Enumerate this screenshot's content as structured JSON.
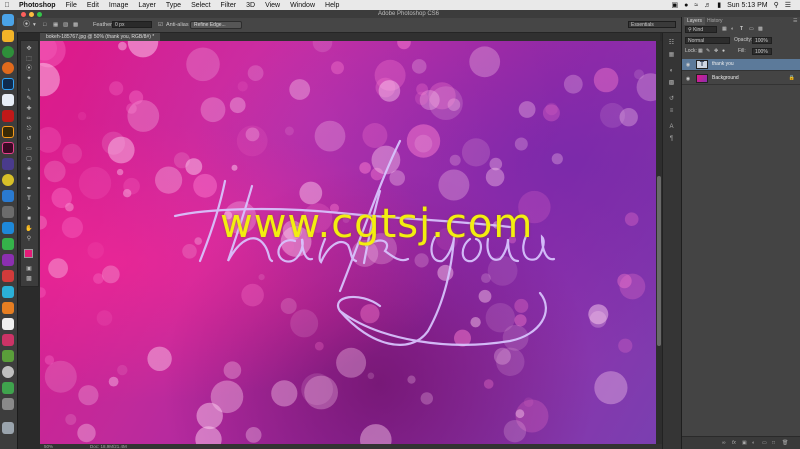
{
  "menubar": {
    "app_name": "Photoshop",
    "items": [
      "File",
      "Edit",
      "Image",
      "Layer",
      "Type",
      "Select",
      "Filter",
      "3D",
      "View",
      "Window",
      "Help"
    ],
    "clock": "Sun 5:13 PM"
  },
  "window": {
    "title": "Adobe Photoshop CS6"
  },
  "options_bar": {
    "feather_label": "Feather:",
    "feather_value": "0 px",
    "anti_alias_label": "Anti-alias",
    "refine_edge_label": "Refine Edge...",
    "workspace_value": "Essentials"
  },
  "document": {
    "tab_title": "bokeh-185767.jpg @ 50% (thank you, RGB/8#) *",
    "script_text": "thank you",
    "watermark": "www.cgtsj.com"
  },
  "status_bar": {
    "zoom": "50%",
    "doc_size": "Doc: 18.9M/21.4M"
  },
  "layers_panel": {
    "tabs": [
      "Layers",
      "History"
    ],
    "kind_value": "Kind",
    "blend_mode": "Normal",
    "opacity_label": "Opacity:",
    "opacity_value": "100%",
    "lock_label": "Lock:",
    "fill_label": "Fill:",
    "fill_value": "100%",
    "layers": [
      {
        "name": "thank you",
        "type": "text",
        "selected": true
      },
      {
        "name": "Background",
        "type": "image",
        "selected": false,
        "locked": true
      }
    ]
  },
  "colors": {
    "foreground": "#e41a78",
    "background": "#ffffff",
    "watermark": "#f3ee10",
    "script": "#d9c6ff"
  },
  "dock_icons": [
    "finder-icon",
    "safari-icon",
    "chrome-icon",
    "firefox-icon",
    "photoshop-icon",
    "after-effects-icon",
    "acrobat-icon",
    "illustrator-icon",
    "indesign-icon",
    "cinema4d-icon",
    "app-icon",
    "trash-icon"
  ]
}
